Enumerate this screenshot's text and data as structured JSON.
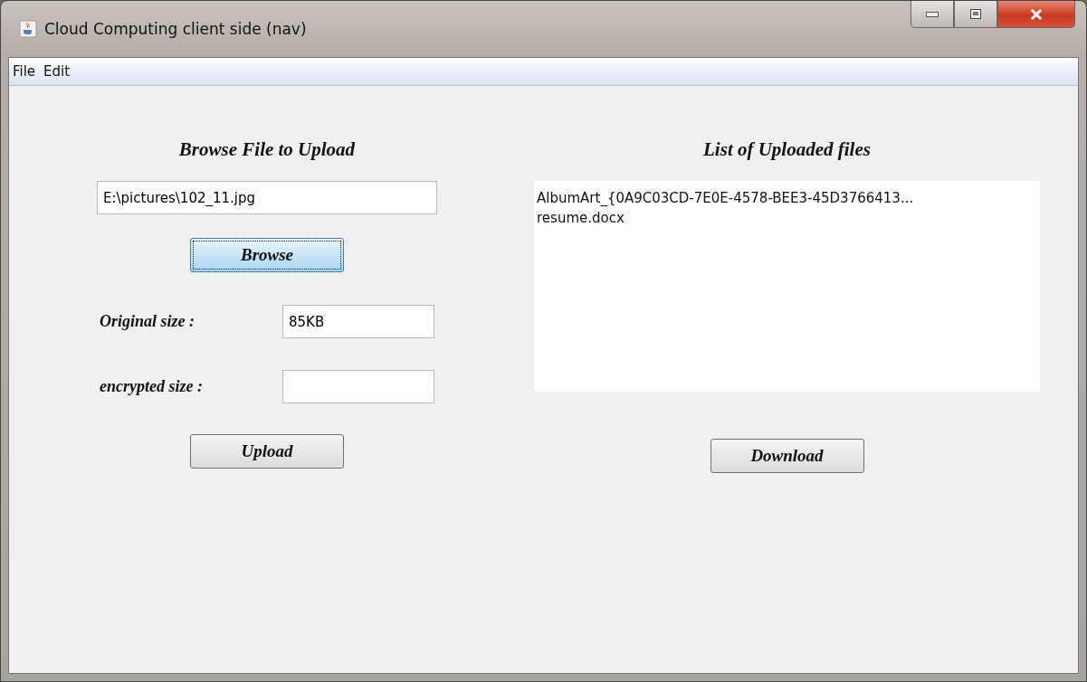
{
  "window": {
    "title": "Cloud Computing client side (nav)"
  },
  "menu": [
    "File",
    "Edit"
  ],
  "upload_panel": {
    "heading": "Browse File to Upload",
    "path_field": {
      "value": "E:\\pictures\\102_11.jpg"
    },
    "browse_button": {
      "label": "Browse",
      "focused": true
    },
    "fields": [
      {
        "label": "Original size :",
        "value": "85KB"
      },
      {
        "label": "encrypted size :"
      }
    ],
    "upload_button": {
      "label": "Upload",
      "focused": false
    }
  },
  "files_panel": {
    "heading": "List of Uploaded files",
    "files": [
      "AlbumArt_{0A9C03CD-7E0E-4578-BEE3-45D3766413...",
      "resume.docx"
    ],
    "download_button": {
      "label": "Download",
      "focused": false
    }
  }
}
